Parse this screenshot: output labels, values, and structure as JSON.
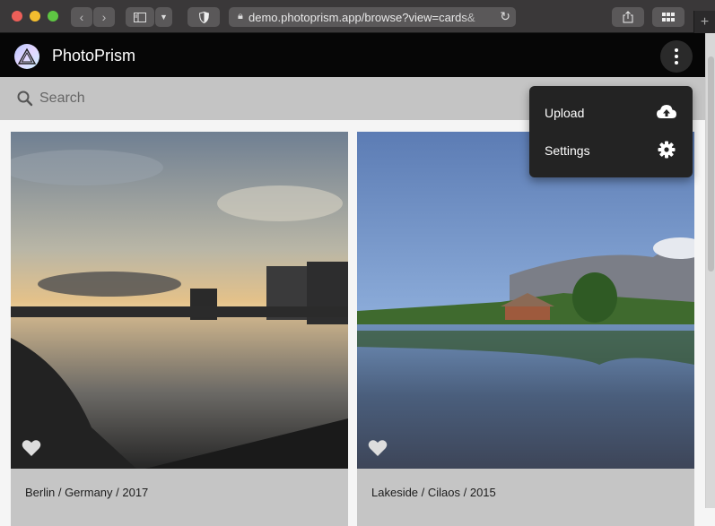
{
  "browser": {
    "url": "demo.photoprism.app/browse?view=cards&",
    "back_icon": "chevron-left-icon",
    "forward_icon": "chevron-right-icon",
    "sidebar_icon": "sidebar-icon",
    "privacy_icon": "shield-icon",
    "reload_icon": "reload-icon",
    "share_icon": "share-icon",
    "tabs_icon": "tab-overview-icon",
    "new_tab_label": "+"
  },
  "app": {
    "title": "PhotoPrism",
    "menu_icon": "more-vertical-icon"
  },
  "search": {
    "placeholder": "Search"
  },
  "menu": {
    "items": [
      {
        "label": "Upload",
        "icon": "cloud-upload-icon"
      },
      {
        "label": "Settings",
        "icon": "gear-icon"
      }
    ]
  },
  "photos": [
    {
      "caption": "Berlin / Germany / 2017",
      "favorite_icon": "heart-icon"
    },
    {
      "caption": "Lakeside / Cilaos / 2015",
      "favorite_icon": "heart-icon"
    }
  ],
  "colors": {
    "appbar": "#060606",
    "menu_bg": "#232323",
    "card_bg": "#c5c5c5",
    "search_bg": "#c4c4c4"
  }
}
